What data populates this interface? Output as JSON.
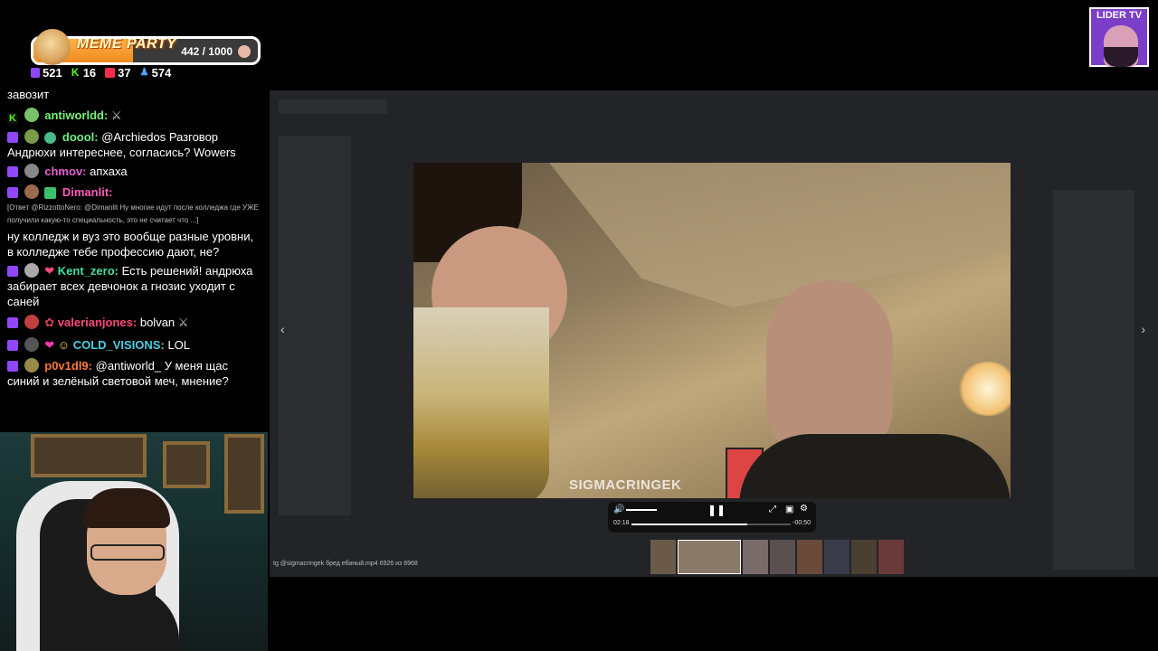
{
  "meme_party": {
    "title": "MEME PARTY",
    "progress_text": "442 / 1000",
    "progress": 0.442
  },
  "stats": [
    {
      "platform": "twitch",
      "count": "521"
    },
    {
      "platform": "kick",
      "count": "16"
    },
    {
      "platform": "vk",
      "count": "37"
    },
    {
      "platform": "viewers",
      "count": "574"
    }
  ],
  "chat": {
    "line0": "завозит",
    "m1": {
      "nick": "antiworldd:",
      "text": ""
    },
    "m2": {
      "nick": "doool:",
      "text": "@Archiedos Разговор Андрюхи интереснее, согласись? Wowers"
    },
    "m3": {
      "nick": "chmov:",
      "text": "апхаха"
    },
    "m4": {
      "nick": "Dimanlit:",
      "reply": "[Ответ @RizzottoNero: @Dimanlit Ну многие идут после колледжа где УЖЕ получили какую-то специальность, это не считает что ...]",
      "text": "ну колледж и вуз это вообще разные уровни, в колледже тебе профессию дают, не?"
    },
    "m5": {
      "nick": "Kent_zero:",
      "text": "Есть решений! андрюха забирает всех девчонок а гнозис уходит с саней"
    },
    "m6": {
      "nick": "valerianjones:",
      "text": "bolvan"
    },
    "m7": {
      "nick": "COLD_VISIONS:",
      "text": "LOL"
    },
    "m8": {
      "nick": "p0v1dl9:",
      "text": "@antiworld_ У меня щас синий и зелёный световой меч, мнение?"
    }
  },
  "player": {
    "watermark": "SIGMACRINGEK",
    "time_current": "02:18",
    "time_remaining": "-00:50",
    "progress": 0.73,
    "caption": "tg @sigmacringek бред ебаный.mp4 6926 из 6968"
  },
  "logo": {
    "text": "LIDER TV"
  },
  "colors": {
    "twitch": "#9146ff",
    "kick": "#53fc18",
    "vk": "#ff2a4d",
    "accent": "#f08a1e"
  }
}
